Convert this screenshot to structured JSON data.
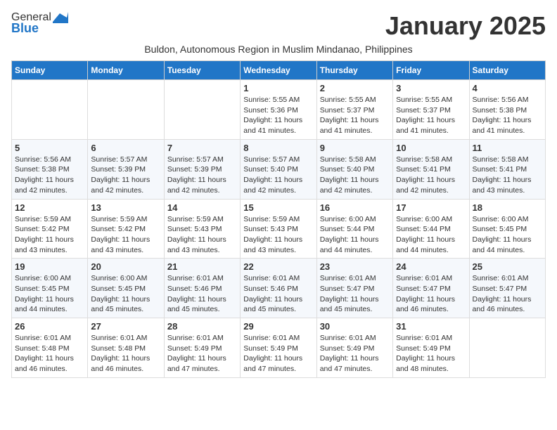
{
  "logo": {
    "general": "General",
    "blue": "Blue"
  },
  "title": "January 2025",
  "subtitle": "Buldon, Autonomous Region in Muslim Mindanao, Philippines",
  "headers": [
    "Sunday",
    "Monday",
    "Tuesday",
    "Wednesday",
    "Thursday",
    "Friday",
    "Saturday"
  ],
  "weeks": [
    [
      {
        "day": "",
        "info": ""
      },
      {
        "day": "",
        "info": ""
      },
      {
        "day": "",
        "info": ""
      },
      {
        "day": "1",
        "info": "Sunrise: 5:55 AM\nSunset: 5:36 PM\nDaylight: 11 hours\nand 41 minutes."
      },
      {
        "day": "2",
        "info": "Sunrise: 5:55 AM\nSunset: 5:37 PM\nDaylight: 11 hours\nand 41 minutes."
      },
      {
        "day": "3",
        "info": "Sunrise: 5:55 AM\nSunset: 5:37 PM\nDaylight: 11 hours\nand 41 minutes."
      },
      {
        "day": "4",
        "info": "Sunrise: 5:56 AM\nSunset: 5:38 PM\nDaylight: 11 hours\nand 41 minutes."
      }
    ],
    [
      {
        "day": "5",
        "info": "Sunrise: 5:56 AM\nSunset: 5:38 PM\nDaylight: 11 hours\nand 42 minutes."
      },
      {
        "day": "6",
        "info": "Sunrise: 5:57 AM\nSunset: 5:39 PM\nDaylight: 11 hours\nand 42 minutes."
      },
      {
        "day": "7",
        "info": "Sunrise: 5:57 AM\nSunset: 5:39 PM\nDaylight: 11 hours\nand 42 minutes."
      },
      {
        "day": "8",
        "info": "Sunrise: 5:57 AM\nSunset: 5:40 PM\nDaylight: 11 hours\nand 42 minutes."
      },
      {
        "day": "9",
        "info": "Sunrise: 5:58 AM\nSunset: 5:40 PM\nDaylight: 11 hours\nand 42 minutes."
      },
      {
        "day": "10",
        "info": "Sunrise: 5:58 AM\nSunset: 5:41 PM\nDaylight: 11 hours\nand 42 minutes."
      },
      {
        "day": "11",
        "info": "Sunrise: 5:58 AM\nSunset: 5:41 PM\nDaylight: 11 hours\nand 43 minutes."
      }
    ],
    [
      {
        "day": "12",
        "info": "Sunrise: 5:59 AM\nSunset: 5:42 PM\nDaylight: 11 hours\nand 43 minutes."
      },
      {
        "day": "13",
        "info": "Sunrise: 5:59 AM\nSunset: 5:42 PM\nDaylight: 11 hours\nand 43 minutes."
      },
      {
        "day": "14",
        "info": "Sunrise: 5:59 AM\nSunset: 5:43 PM\nDaylight: 11 hours\nand 43 minutes."
      },
      {
        "day": "15",
        "info": "Sunrise: 5:59 AM\nSunset: 5:43 PM\nDaylight: 11 hours\nand 43 minutes."
      },
      {
        "day": "16",
        "info": "Sunrise: 6:00 AM\nSunset: 5:44 PM\nDaylight: 11 hours\nand 44 minutes."
      },
      {
        "day": "17",
        "info": "Sunrise: 6:00 AM\nSunset: 5:44 PM\nDaylight: 11 hours\nand 44 minutes."
      },
      {
        "day": "18",
        "info": "Sunrise: 6:00 AM\nSunset: 5:45 PM\nDaylight: 11 hours\nand 44 minutes."
      }
    ],
    [
      {
        "day": "19",
        "info": "Sunrise: 6:00 AM\nSunset: 5:45 PM\nDaylight: 11 hours\nand 44 minutes."
      },
      {
        "day": "20",
        "info": "Sunrise: 6:00 AM\nSunset: 5:45 PM\nDaylight: 11 hours\nand 45 minutes."
      },
      {
        "day": "21",
        "info": "Sunrise: 6:01 AM\nSunset: 5:46 PM\nDaylight: 11 hours\nand 45 minutes."
      },
      {
        "day": "22",
        "info": "Sunrise: 6:01 AM\nSunset: 5:46 PM\nDaylight: 11 hours\nand 45 minutes."
      },
      {
        "day": "23",
        "info": "Sunrise: 6:01 AM\nSunset: 5:47 PM\nDaylight: 11 hours\nand 45 minutes."
      },
      {
        "day": "24",
        "info": "Sunrise: 6:01 AM\nSunset: 5:47 PM\nDaylight: 11 hours\nand 46 minutes."
      },
      {
        "day": "25",
        "info": "Sunrise: 6:01 AM\nSunset: 5:47 PM\nDaylight: 11 hours\nand 46 minutes."
      }
    ],
    [
      {
        "day": "26",
        "info": "Sunrise: 6:01 AM\nSunset: 5:48 PM\nDaylight: 11 hours\nand 46 minutes."
      },
      {
        "day": "27",
        "info": "Sunrise: 6:01 AM\nSunset: 5:48 PM\nDaylight: 11 hours\nand 46 minutes."
      },
      {
        "day": "28",
        "info": "Sunrise: 6:01 AM\nSunset: 5:49 PM\nDaylight: 11 hours\nand 47 minutes."
      },
      {
        "day": "29",
        "info": "Sunrise: 6:01 AM\nSunset: 5:49 PM\nDaylight: 11 hours\nand 47 minutes."
      },
      {
        "day": "30",
        "info": "Sunrise: 6:01 AM\nSunset: 5:49 PM\nDaylight: 11 hours\nand 47 minutes."
      },
      {
        "day": "31",
        "info": "Sunrise: 6:01 AM\nSunset: 5:49 PM\nDaylight: 11 hours\nand 48 minutes."
      },
      {
        "day": "",
        "info": ""
      }
    ]
  ]
}
